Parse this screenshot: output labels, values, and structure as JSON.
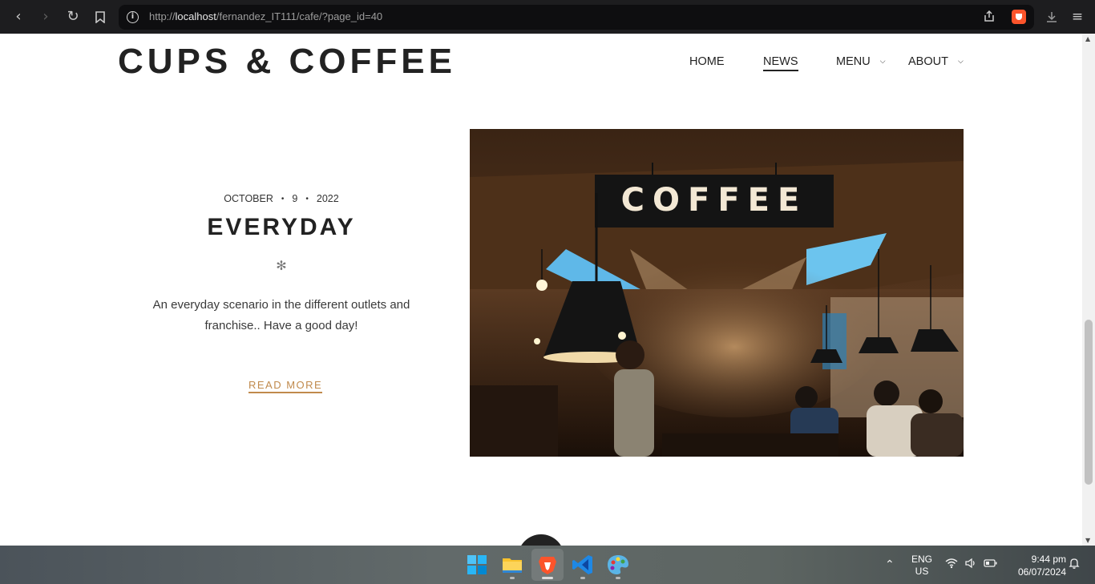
{
  "browser": {
    "url_prefix": "http://",
    "url_host": "localhost",
    "url_path": "/fernandez_IT111/cafe/?page_id=40"
  },
  "site": {
    "title": "CUPS & COFFEE",
    "nav": [
      {
        "label": "HOME",
        "active": false,
        "has_dropdown": false
      },
      {
        "label": "NEWS",
        "active": true,
        "has_dropdown": false
      },
      {
        "label": "MENU",
        "active": false,
        "has_dropdown": true
      },
      {
        "label": "ABOUT",
        "active": false,
        "has_dropdown": true
      }
    ]
  },
  "post": {
    "date_month": "OCTOBER",
    "date_day": "9",
    "date_year": "2022",
    "title": "EVERYDAY",
    "ornament": "✻",
    "excerpt": "An everyday scenario in the different outlets and franchise.. Have a good day!",
    "read_more": "READ MORE",
    "image_sign_text": "COFFEE"
  },
  "taskbar": {
    "apps": [
      "start-icon",
      "file-explorer-icon",
      "brave-browser-icon",
      "vscode-icon",
      "paint-icon"
    ],
    "language_line1": "ENG",
    "language_line2": "US",
    "time": "9:44 pm",
    "date": "06/07/2024"
  },
  "colors": {
    "accent": "#c08a4c",
    "text_dark": "#222222",
    "browser_bg": "#1d1d1f"
  }
}
